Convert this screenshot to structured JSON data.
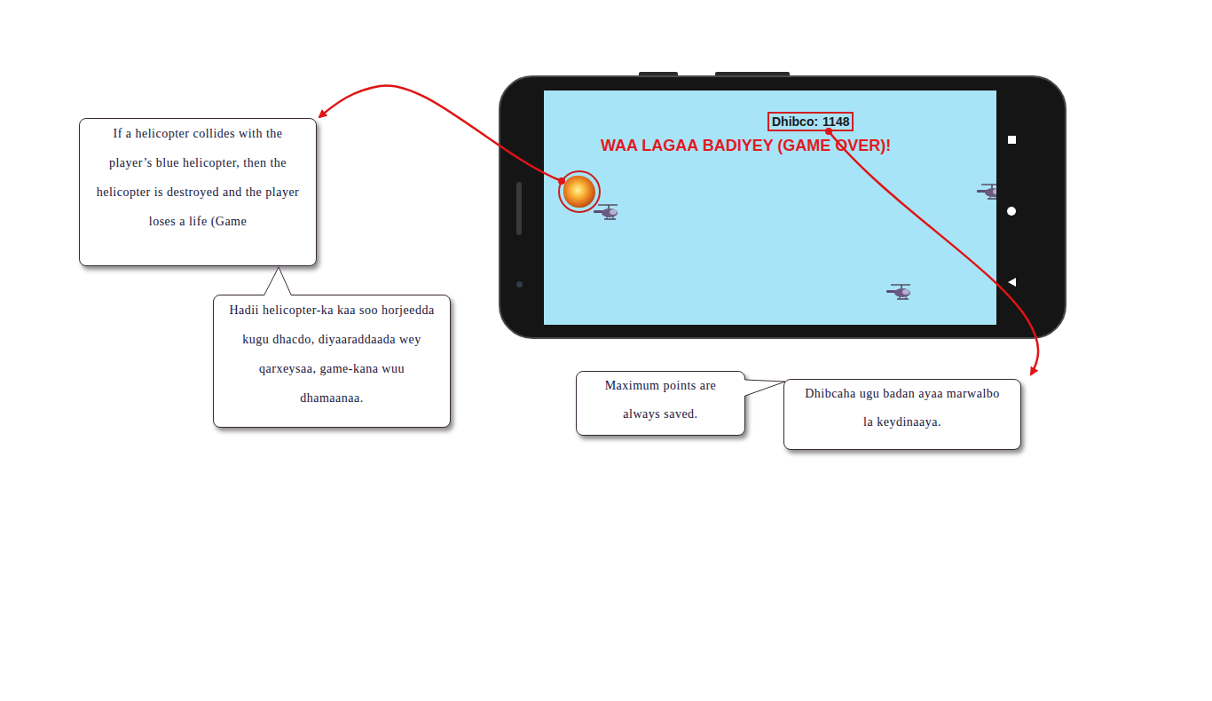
{
  "phone": {
    "score": {
      "label": "Dhibco:",
      "value": "1148",
      "highlighted": true
    },
    "status": "WAA LAGAA BADIYEY (GAME OVER)!",
    "sprites": [
      {
        "kind": "explosion",
        "highlighted": true
      },
      {
        "kind": "helicopter",
        "highlighted": false
      },
      {
        "kind": "helicopter",
        "highlighted": false
      },
      {
        "kind": "helicopter",
        "highlighted": false
      }
    ]
  },
  "callouts": [
    {
      "text": "If a helicopter collides with the player’s blue helicopter, then the helicopter is destroyed and the player loses a life (Game"
    },
    {
      "text": "Hadii helicopter-ka kaa soo horjeedda kugu dhacdo, diyaaraddaada wey qarxeysaa, game-kana wuu dhamaanaa."
    },
    {
      "text": "Maximum points are always saved."
    },
    {
      "text": "Dhibcaha ugu badan ayaa marwalbo la keydinaaya."
    }
  ]
}
